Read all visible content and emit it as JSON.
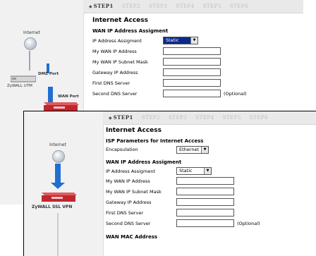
{
  "steps": [
    "STEP1",
    "STEP2",
    "STEP3",
    "STEP4",
    "STEP5",
    "STEP6"
  ],
  "back": {
    "side": {
      "internet_label": "Internet",
      "dmz_label": "DMZ Port",
      "device_label": "ZyWALL UTM",
      "wan_label": "WAN Port"
    },
    "title": "Internet Access",
    "section": "WAN IP Address Assigment",
    "assignment_label": "IP Address Assigment",
    "assignment_value": "Static",
    "fields": [
      {
        "label": "My WAN IP Address",
        "value": ""
      },
      {
        "label": "My WAN IP Subnet Mask",
        "value": ""
      },
      {
        "label": "Gateway IP Address",
        "value": ""
      },
      {
        "label": "First DNS Server",
        "value": ""
      },
      {
        "label": "Second DNS Server",
        "value": "",
        "note": "(Optional)"
      }
    ]
  },
  "front": {
    "side": {
      "internet_label": "Internet",
      "device_label": "ZyWALL SSL VPN"
    },
    "title": "Internet Access",
    "isp_section": "ISP Parameters for Internet Access",
    "encapsulation_label": "Encapsulation",
    "encapsulation_value": "Ethernet",
    "section": "WAN IP Address Assigment",
    "assignment_label": "IP Address Assigment",
    "assignment_value": "Static",
    "fields": [
      {
        "label": "My WAN IP Address",
        "value": ""
      },
      {
        "label": "My WAN IP Subnet Mask",
        "value": ""
      },
      {
        "label": "Gateway IP Address",
        "value": ""
      },
      {
        "label": "First DNS Server",
        "value": ""
      },
      {
        "label": "Second DNS Server",
        "value": "",
        "note": "(Optional)"
      }
    ],
    "mac_section": "WAN MAC Address"
  },
  "colors": {
    "arrow": "#1f6fd0",
    "device": "#c0272d",
    "selected": "#0a2a8a"
  }
}
